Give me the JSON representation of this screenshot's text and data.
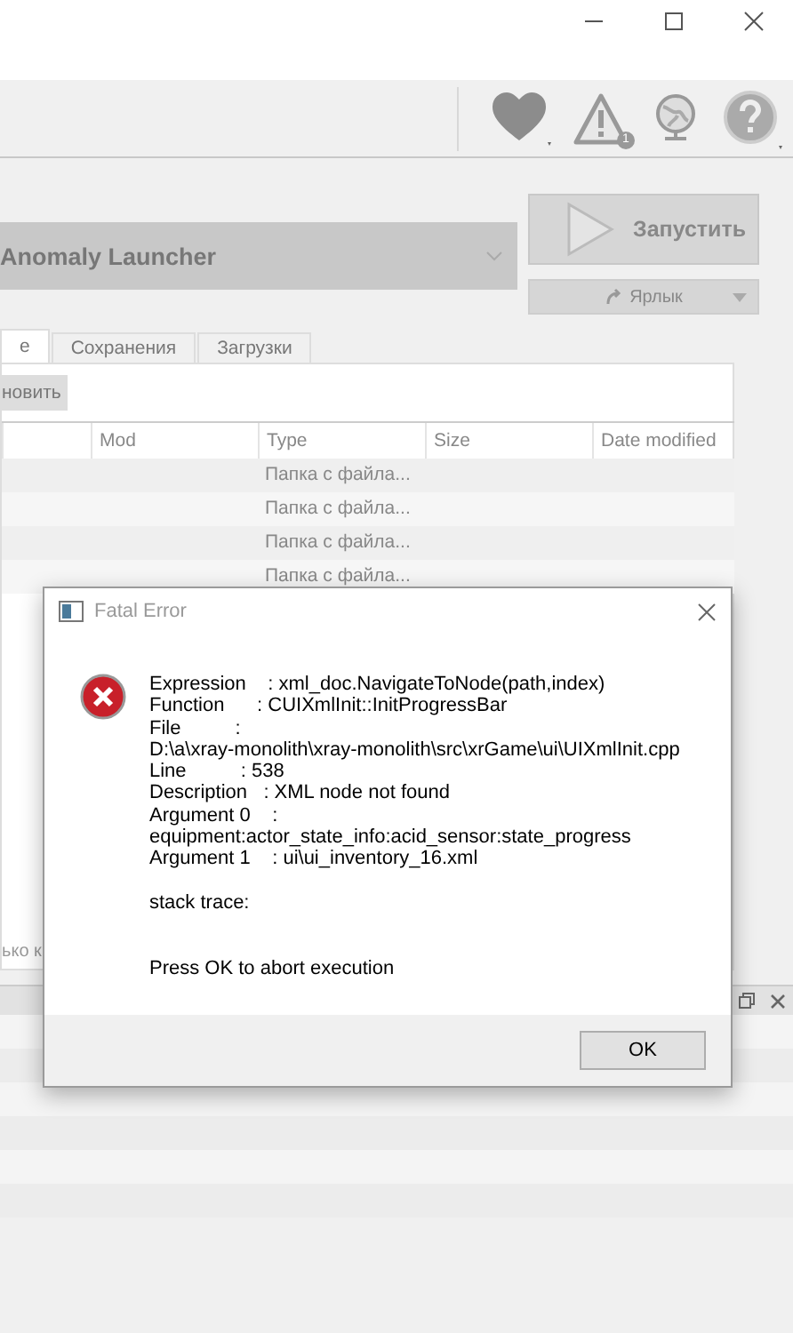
{
  "toolbar": {
    "warning_badge": "1"
  },
  "profile_dropdown": {
    "value": "Anomaly Launcher"
  },
  "launch_button": {
    "label": "Запустить"
  },
  "shortcut_button": {
    "label": "Ярлык"
  },
  "tabs": [
    {
      "label": "е",
      "selected": true
    },
    {
      "label": "Сохранения",
      "selected": false
    },
    {
      "label": "Загрузки",
      "selected": false
    }
  ],
  "refresh_button": {
    "label": "новить"
  },
  "table": {
    "columns": [
      "Mod",
      "Type",
      "Size",
      "Date modified"
    ],
    "rows": [
      {
        "type": "Папка с файла..."
      },
      {
        "type": "Папка с файла..."
      },
      {
        "type": "Папка с файла..."
      },
      {
        "type": "Папка с файла..."
      }
    ]
  },
  "status_text": "ько к",
  "dialog": {
    "title": "Fatal Error",
    "paragraphs": [
      [
        "Expression    : xml_doc.NavigateToNode(path,index)",
        "Function      : CUIXmlInit::InitProgressBar",
        "File          :",
        "D:\\a\\xray-monolith\\xray-monolith\\src\\xrGame\\ui\\UIXmlInit.cpp",
        "Line          : 538",
        "Description   : XML node not found",
        "Argument 0    :",
        "equipment:actor_state_info:acid_sensor:state_progress",
        "Argument 1    : ui\\ui_inventory_16.xml"
      ],
      [
        "stack trace:"
      ],
      [
        "Press OK to abort execution"
      ]
    ],
    "button": "OK"
  }
}
